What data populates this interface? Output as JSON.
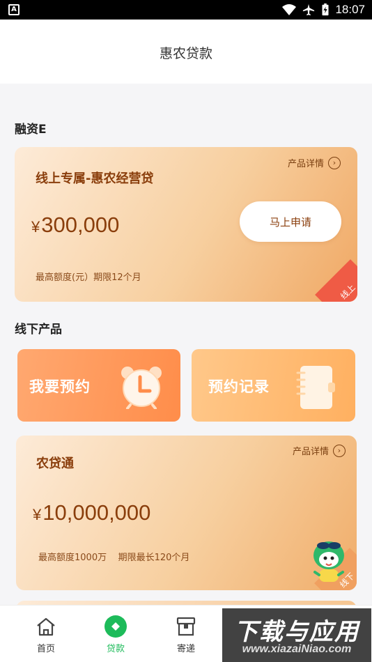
{
  "status_bar": {
    "time": "18:07",
    "left_icon": "A"
  },
  "header": {
    "title": "惠农贷款"
  },
  "section_online": {
    "title": "融资E"
  },
  "online_card": {
    "name": "线上专属-惠农经营贷",
    "currency": "¥",
    "amount": "300,000",
    "detail_label": "产品详情",
    "subtitle": "最高额度(元）期限12个月",
    "apply_label": "马上申请",
    "corner_tag": "线上"
  },
  "section_offline": {
    "title": "线下产品"
  },
  "tiles": {
    "book": {
      "label": "我要预约"
    },
    "records": {
      "label": "预约记录"
    }
  },
  "offline_card": {
    "name": "农贷通",
    "currency": "¥",
    "amount": "10,000,000",
    "detail_label": "产品详情",
    "subtitle": "最高额度1000万    期限最长120个月",
    "corner_tag": "线下"
  },
  "bottom_nav": {
    "items": [
      {
        "label": "首页",
        "icon": "home-icon"
      },
      {
        "label": "贷款",
        "icon": "loan-icon"
      },
      {
        "label": "寄递",
        "icon": "parcel-icon"
      }
    ]
  },
  "watermark": {
    "main": "下载与应用",
    "sub": "www.xiazaiNiao.com"
  },
  "colors": {
    "accent_green": "#1dbb5a",
    "brown_text": "#8a3e0c",
    "tag_red": "#ef5b45"
  }
}
